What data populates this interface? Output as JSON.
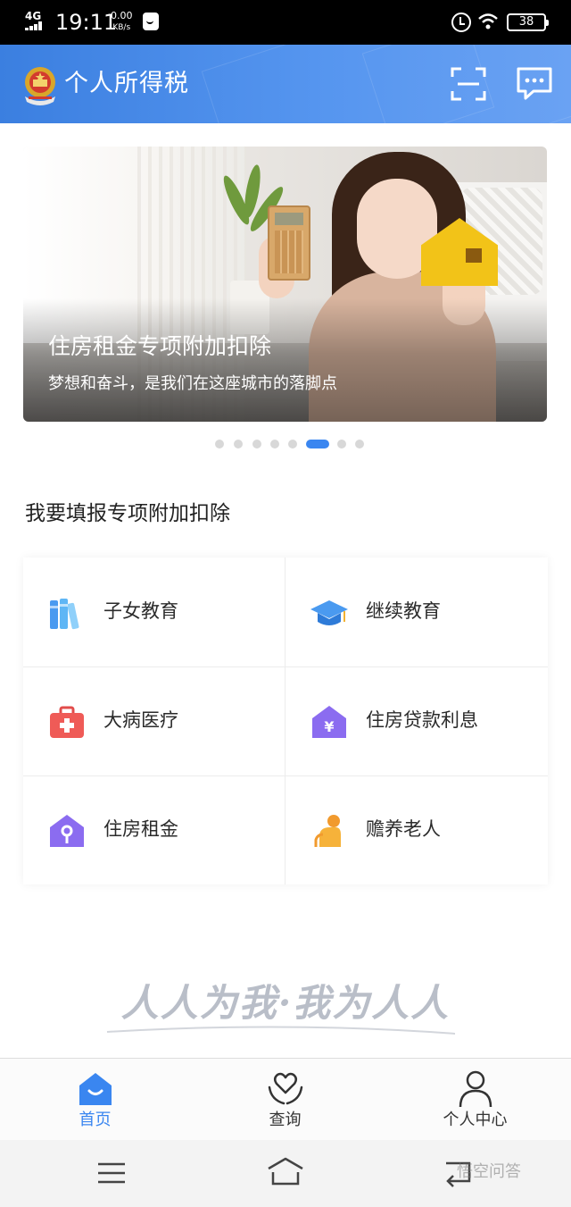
{
  "status_bar": {
    "network": "4G",
    "time": "19:11",
    "speed_value": "0.00",
    "speed_unit": "KB/s",
    "battery": "38"
  },
  "header": {
    "title": "个人所得税",
    "icons": [
      "national-emblem-icon",
      "scan-icon",
      "message-icon"
    ]
  },
  "banner": {
    "title": "住房租金专项附加扣除",
    "subtitle": "梦想和奋斗，是我们在这座城市的落脚点",
    "page_count": 8,
    "active_index": 5
  },
  "section": {
    "title": "我要填报专项附加扣除"
  },
  "deductions": [
    {
      "label": "子女教育",
      "icon": "books-icon"
    },
    {
      "label": "继续教育",
      "icon": "graduation-cap-icon"
    },
    {
      "label": "大病医疗",
      "icon": "medical-kit-icon"
    },
    {
      "label": "住房贷款利息",
      "icon": "house-yuan-icon"
    },
    {
      "label": "住房租金",
      "icon": "house-key-icon"
    },
    {
      "label": "赡养老人",
      "icon": "elderly-person-icon"
    }
  ],
  "slogan": "人人为我·我为人人",
  "tabs": [
    {
      "label": "首页",
      "icon": "home-icon",
      "active": true
    },
    {
      "label": "查询",
      "icon": "heart-hands-icon",
      "active": false
    },
    {
      "label": "个人中心",
      "icon": "person-icon",
      "active": false
    }
  ],
  "watermark": "悟空问答",
  "colors": {
    "accent": "#3a86f0",
    "header_start": "#3b7fe0",
    "header_end": "#6aa2f3"
  }
}
